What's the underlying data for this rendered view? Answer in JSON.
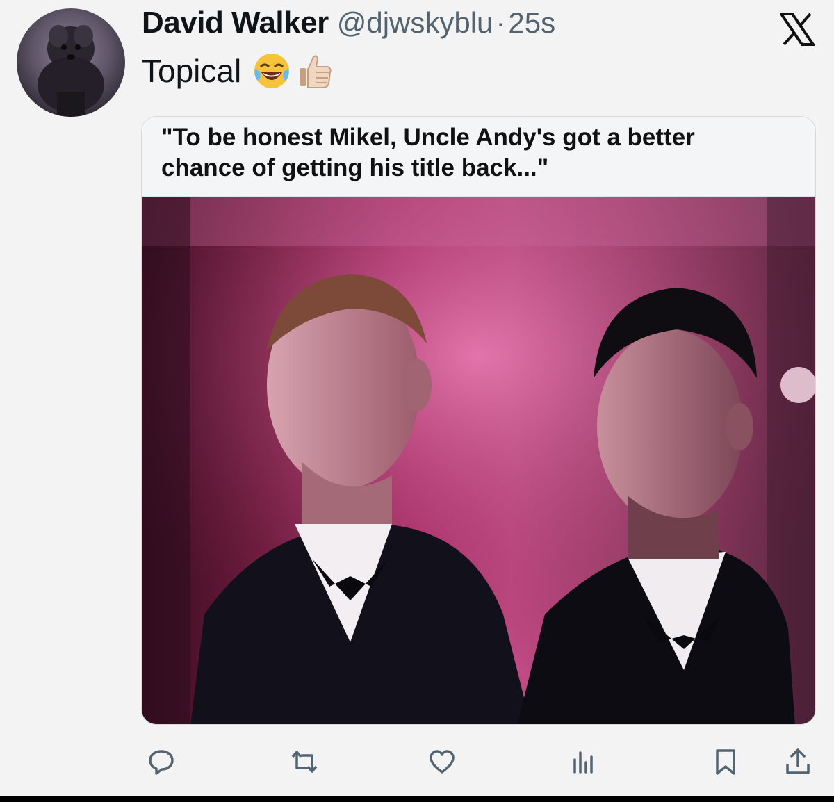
{
  "tweet": {
    "display_name": "David Walker",
    "handle": "@djwskyblu",
    "separator": "·",
    "time": "25s",
    "text": "Topical",
    "emojis": [
      "face-with-tears-of-joy",
      "thumbs-up"
    ]
  },
  "media": {
    "caption_line1": "\"To be honest Mikel, Uncle Andy's got a better",
    "caption_line2": "chance of getting his title back...\""
  },
  "actions": [
    "reply-icon",
    "retweet-icon",
    "like-icon",
    "views-icon",
    "bookmark-icon",
    "share-icon"
  ],
  "colors": {
    "text_primary": "#0f1419",
    "text_secondary": "#536471",
    "background": "#f3f3f3"
  }
}
